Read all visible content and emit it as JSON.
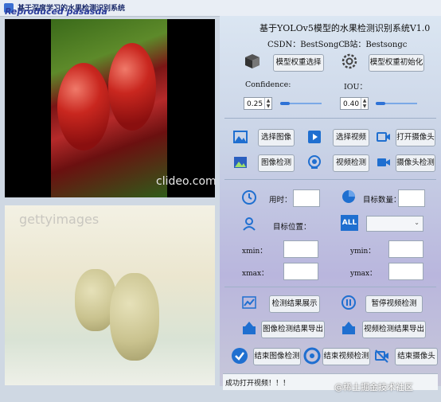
{
  "window": {
    "title": "基于深度学习的水果检测识别系统",
    "watermark": "Reproduced pasasda"
  },
  "header": {
    "title": "基于YOLOv5模型的水果检测识别系统V1.0",
    "csdn": "CSDN：BestSongC",
    "bilibili": "B站：Bestsongc"
  },
  "model": {
    "select_label": "模型权重选择",
    "init_label": "模型权重初始化"
  },
  "params": {
    "confidence_label": "Confidence:",
    "confidence_value": "0.25",
    "confidence_level": 0.25,
    "iou_label": "IOU：",
    "iou_value": "0.40",
    "iou_level": 0.4
  },
  "actions": {
    "select_image": "选择图像",
    "select_video": "选择视频",
    "open_camera": "打开摄像头",
    "image_detect": "图像检测",
    "video_detect": "视频检测",
    "camera_detect": "摄像头检测"
  },
  "info": {
    "time_label": "用时：",
    "count_label": "目标数量：",
    "position_label": "目标位置：",
    "all_icon": "ALL",
    "xmin_label": "xmin：",
    "ymin_label": "ymin：",
    "xmax_label": "xmax：",
    "ymax_label": "ymax："
  },
  "results": {
    "show_results": "检测结果展示",
    "pause_video": "暂停视频检测",
    "export_image": "图像检测结果导出",
    "export_video": "视频检测结果导出",
    "end_image": "结束图像检测",
    "end_video": "结束视频检测",
    "end_camera": "结束摄像头"
  },
  "media": {
    "video_watermark": "clideo.com",
    "image_watermark": "gettyimages"
  },
  "status": {
    "message": "成功打开视频！！！"
  },
  "brand": {
    "text": "@稀土掘金技术社区"
  }
}
